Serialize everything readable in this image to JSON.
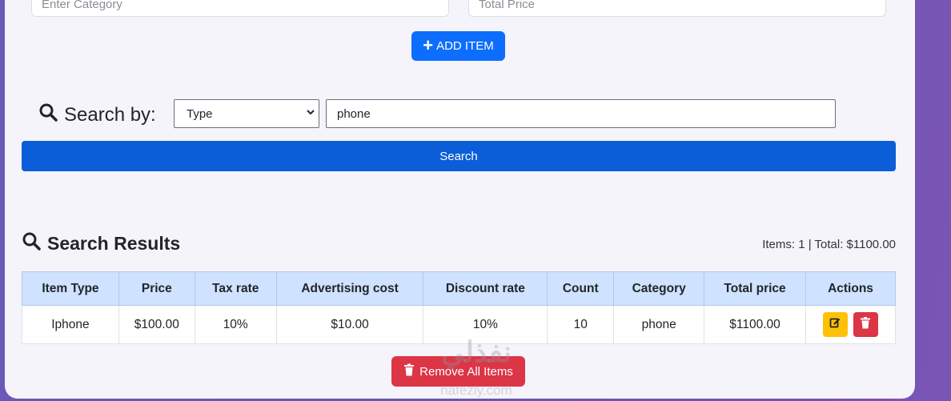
{
  "form": {
    "category_placeholder": "Enter Category",
    "total_price_placeholder": "Total Price",
    "add_button_label": "ADD ITEM"
  },
  "search": {
    "label": "Search by:",
    "select_value": "Type",
    "query_value": "phone",
    "button_label": "Search"
  },
  "results": {
    "title": "Search Results",
    "summary": "Items: 1 | Total: $1100.00",
    "columns": [
      "Item Type",
      "Price",
      "Tax rate",
      "Advertising cost",
      "Discount rate",
      "Count",
      "Category",
      "Total price",
      "Actions"
    ],
    "rows": [
      {
        "type": "Iphone",
        "price": "$100.00",
        "tax": "10%",
        "ads": "$10.00",
        "discount": "10%",
        "count": "10",
        "category": "phone",
        "total": "$1100.00"
      }
    ],
    "remove_all_label": "Remove All Items"
  },
  "watermark": {
    "text": "نفذلي",
    "sub": "nafezly.com"
  },
  "colors": {
    "primary": "#0d6efd",
    "danger": "#dc3545",
    "warning": "#ffc107",
    "table_header": "#cfe2ff"
  }
}
